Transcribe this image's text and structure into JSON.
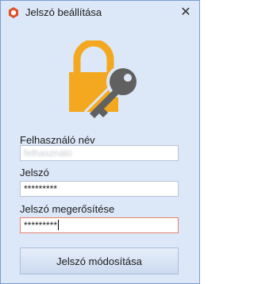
{
  "window": {
    "title": "Jelszó beállítása",
    "app_icon": "red-hexagon-app-icon",
    "close_icon": "close-icon",
    "close_glyph": "✕"
  },
  "illustration": {
    "icons": [
      "padlock-icon",
      "key-icon"
    ],
    "colors": {
      "padlock": "#f4a81f",
      "key": "#606060"
    }
  },
  "form": {
    "username_label": "Felhasználó név",
    "username_value": "felhasználó",
    "password_label": "Jelszó",
    "password_value": "*********",
    "confirm_label": "Jelszó megerősítése",
    "confirm_value": "*********",
    "submit_label": "Jelszó módosítása"
  },
  "colors": {
    "window_bg": "#dce8f8",
    "border": "#7a9cd3",
    "focus_border": "#e8806f"
  }
}
